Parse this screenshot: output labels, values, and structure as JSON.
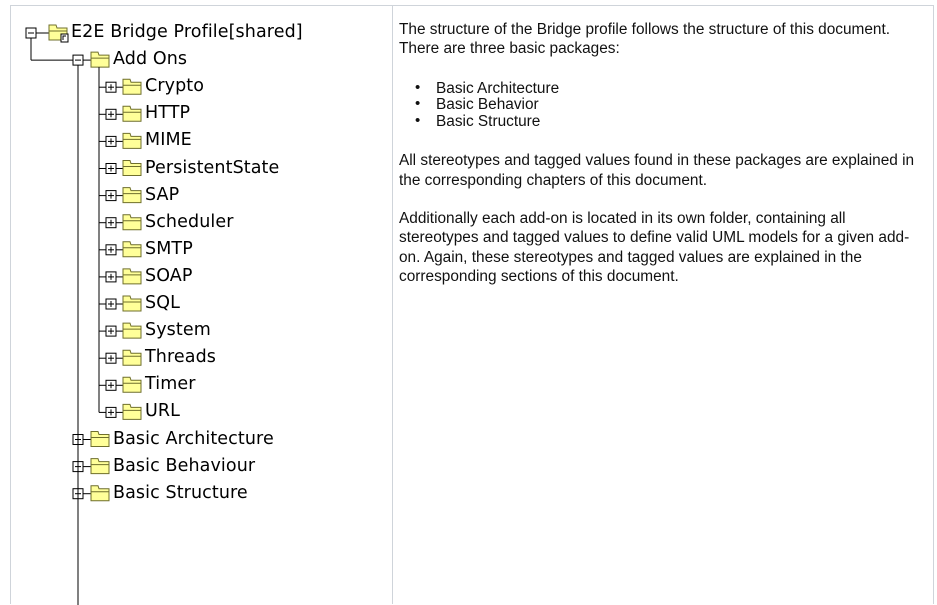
{
  "tree": {
    "root": {
      "label": "E2E Bridge Profile[shared]",
      "icon": "shared-package-icon",
      "expanded": true
    },
    "add_ons": {
      "label": "Add Ons",
      "icon": "folder-icon",
      "expanded": true
    },
    "add_on_items": [
      "Crypto",
      "HTTP",
      "MIME",
      "PersistentState",
      "SAP",
      "Scheduler",
      "SMTP",
      "SOAP",
      "SQL",
      "System",
      "Threads",
      "Timer",
      "URL"
    ],
    "packages": [
      "Basic Architecture",
      "Basic Behaviour",
      "Basic Structure"
    ],
    "colors": {
      "line": "#000000",
      "folder_fill": "#ffff99",
      "folder_stroke": "#6f6f2c"
    }
  },
  "description": {
    "intro": "The structure of the Bridge profile follows the structure of this document. There are three basic packages:",
    "bullets": [
      "Basic Architecture",
      "Basic Behavior",
      "Basic Structure"
    ],
    "para2": "All stereotypes and tagged values found in these packages are explained in the corresponding chapters of this document.",
    "para3": "Additionally each add-on is located in its own folder, containing all stereotypes and tagged values to define valid UML models for a given add-on. Again, these stereotypes and tagged values are explained in the corresponding sections of this document."
  }
}
